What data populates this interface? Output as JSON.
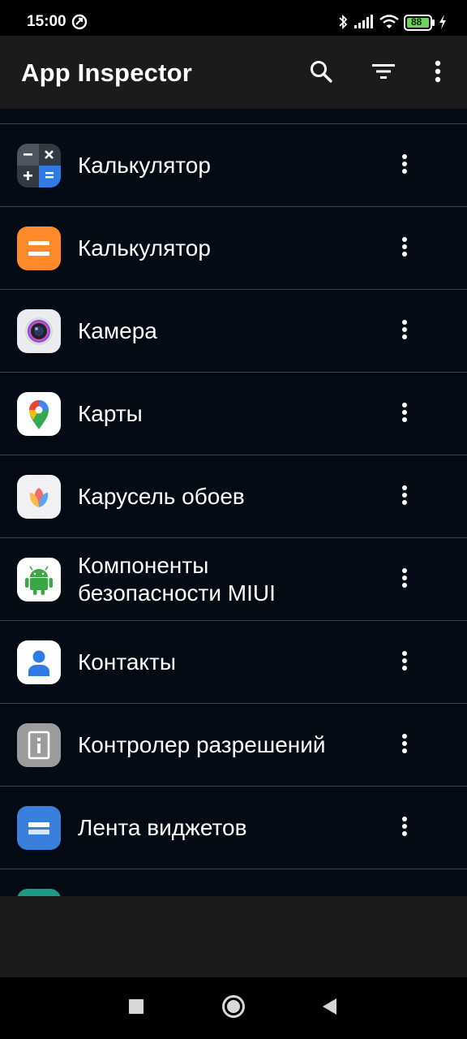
{
  "status_bar": {
    "time": "15:00",
    "battery": "88"
  },
  "toolbar": {
    "title": "App Inspector"
  },
  "apps": [
    {
      "label": "Калькулятор",
      "icon": "calculator-grid-icon"
    },
    {
      "label": "Калькулятор",
      "icon": "calculator-orange-icon"
    },
    {
      "label": "Камера",
      "icon": "camera-icon"
    },
    {
      "label": "Карты",
      "icon": "maps-pin-icon"
    },
    {
      "label": "Карусель обоев",
      "icon": "wallpaper-carousel-icon"
    },
    {
      "label_line1": "Компоненты",
      "label_line2": "безопасности MIUI",
      "icon": "android-robot-icon"
    },
    {
      "label": "Контакты",
      "icon": "contacts-person-icon"
    },
    {
      "label": "Контролер разрешений",
      "icon": "permission-controller-icon"
    },
    {
      "label": "Лента виджетов",
      "icon": "widget-feed-icon"
    }
  ],
  "colors": {
    "background": "#050b14",
    "toolbar": "#1b1b1b",
    "divider": "#3c4450",
    "battery_green": "#6ed35a"
  }
}
